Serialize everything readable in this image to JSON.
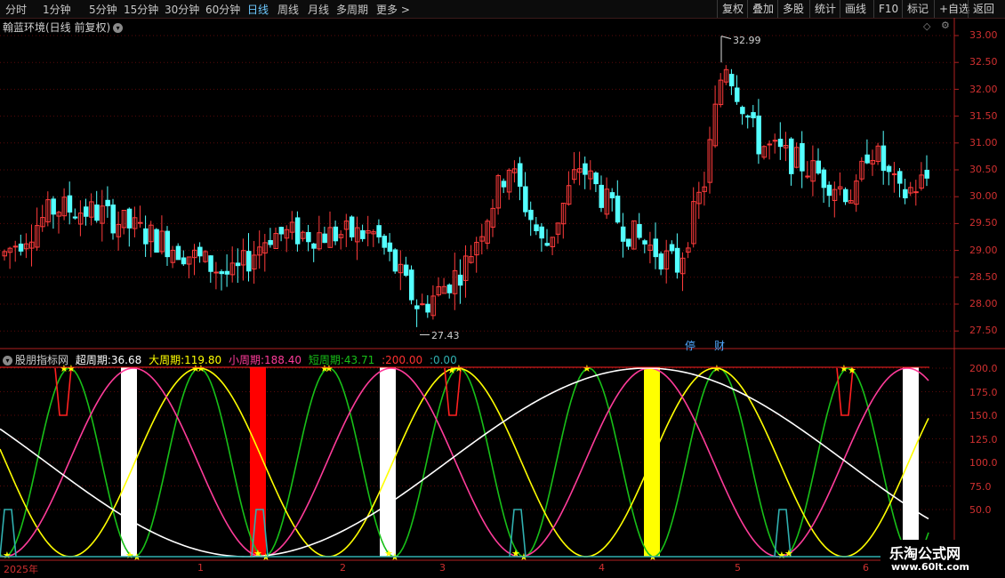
{
  "toolbar": {
    "periods": [
      "分时",
      "1分钟",
      "5分钟",
      "15分钟",
      "30分钟",
      "60分钟",
      "日线",
      "周线",
      "月线",
      "多周期",
      "更多"
    ],
    "active_period": "日线",
    "more_arrow": ">",
    "buttons": [
      "复权",
      "叠加",
      "多股",
      "统计",
      "画线",
      "F10",
      "标记",
      "+自选",
      "返回"
    ]
  },
  "main_panel": {
    "title": "翰蓝环境(日线 前复权)",
    "high_label": "32.99",
    "low_label": "27.43",
    "badges": [
      "停",
      "财"
    ],
    "y_ticks": [
      "33.00",
      "32.50",
      "32.00",
      "31.50",
      "31.00",
      "30.50",
      "30.00",
      "29.50",
      "29.00",
      "28.50",
      "28.00",
      "27.50"
    ]
  },
  "indicator_panel": {
    "name": "股朋指标网",
    "legend": [
      {
        "label": "超周期:",
        "value": "36.68",
        "color": "#ffffff"
      },
      {
        "label": "大周期:",
        "value": "119.80",
        "color": "#ffff00"
      },
      {
        "label": "小周期:",
        "value": "188.40",
        "color": "#ff3c9a"
      },
      {
        "label": "短周期:",
        "value": "43.71",
        "color": "#18c018"
      },
      {
        "label": ":",
        "value": "200.00",
        "color": "#ff3030"
      },
      {
        "label": ":",
        "value": "0.00",
        "color": "#30b0b0"
      }
    ],
    "y_ticks": [
      "200.0",
      "175.0",
      "150.0",
      "125.0",
      "100.0",
      "75.0",
      "50.0"
    ]
  },
  "x_axis": {
    "labels": [
      "2025年",
      "1",
      "2",
      "3",
      "4",
      "5",
      "6"
    ]
  },
  "logo": {
    "line1": "乐淘公式网",
    "line2": "www.60lt.com"
  },
  "colors": {
    "up": "#ff3b3b",
    "down": "#54ffff",
    "grid": "#5a0a0a",
    "axis": "#b02020"
  }
}
